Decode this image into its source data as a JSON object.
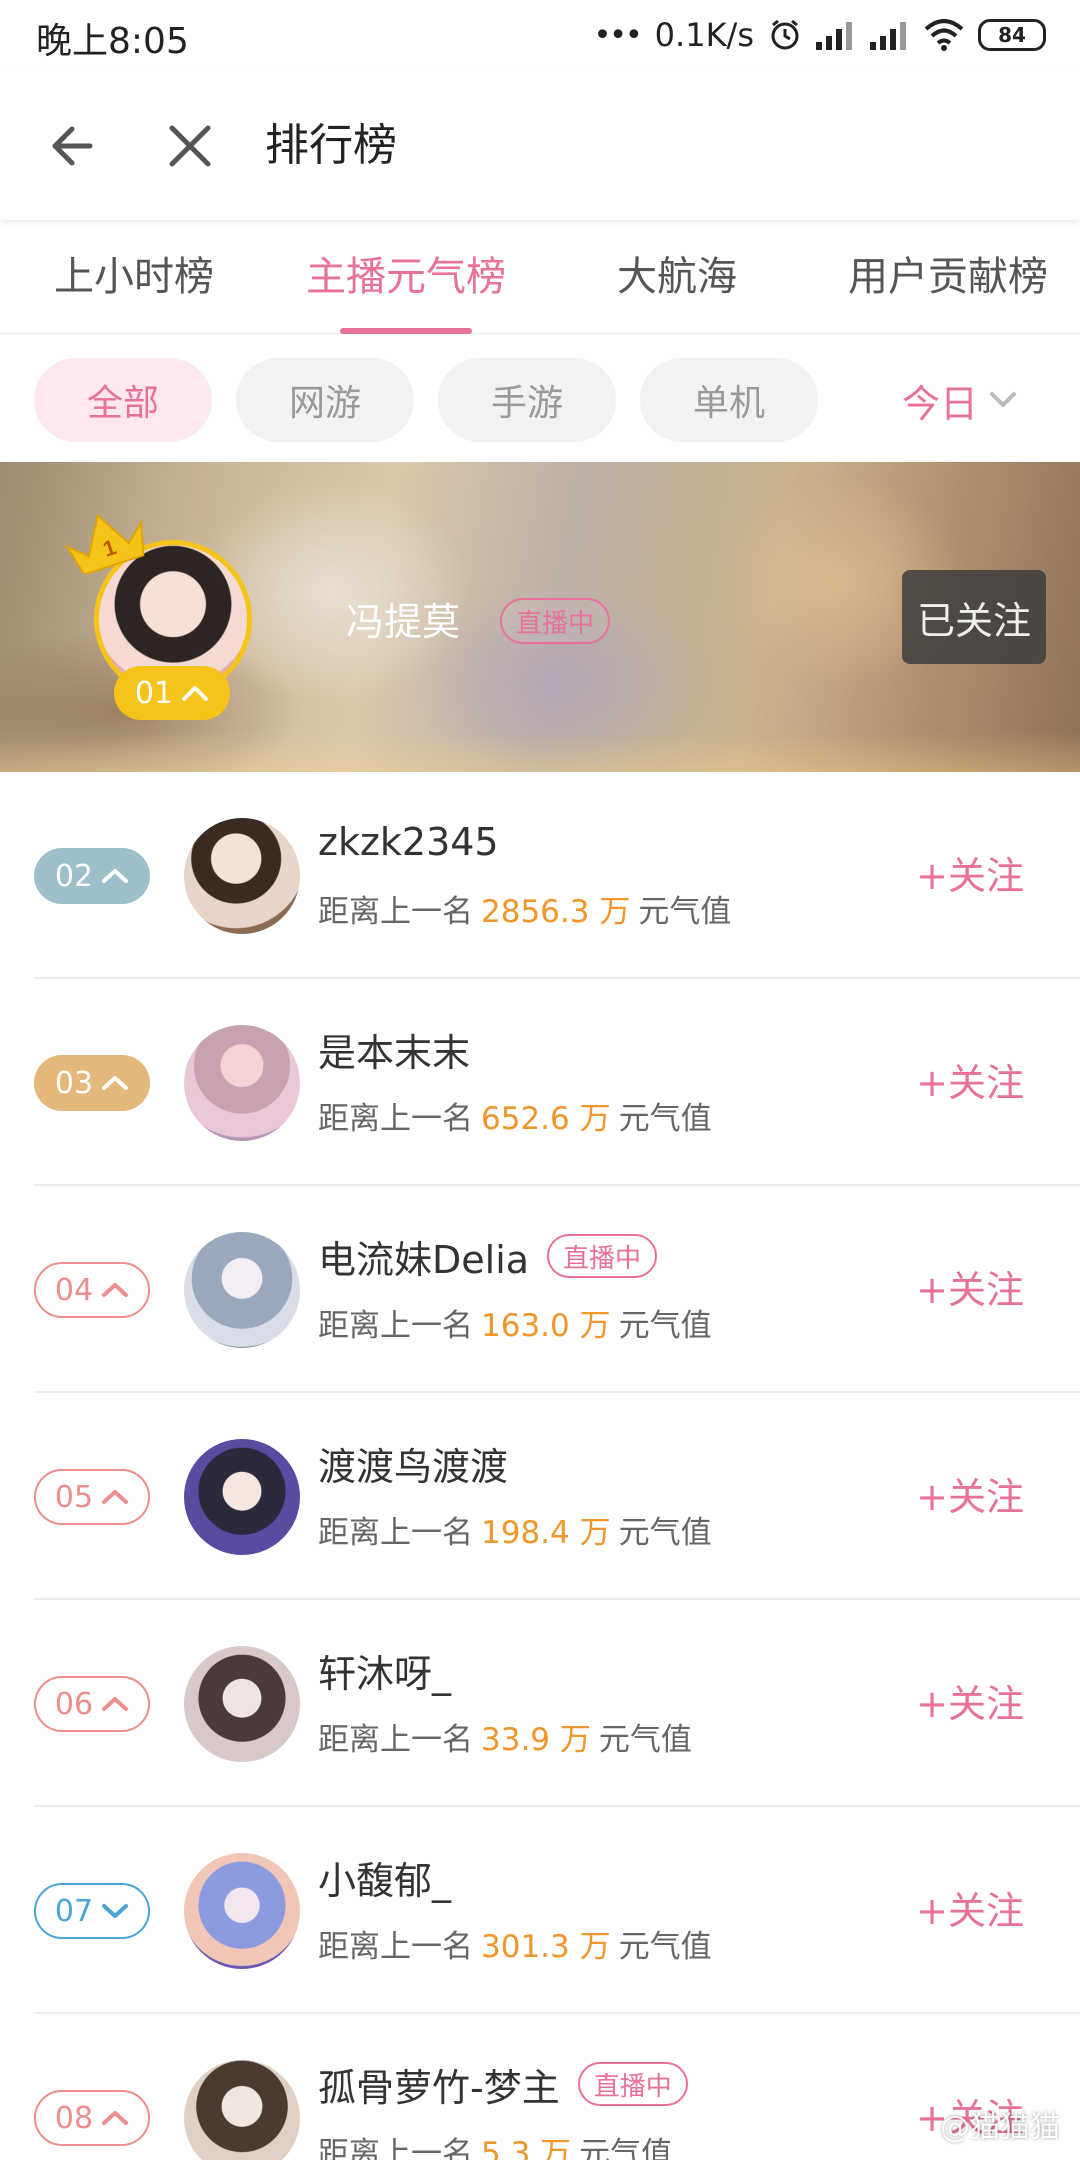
{
  "status_bar": {
    "time": "晚上8:05",
    "network_speed": "0.1K/s",
    "battery": "84"
  },
  "header": {
    "title": "排行榜"
  },
  "tabs": [
    {
      "label": "上小时榜",
      "active": false
    },
    {
      "label": "主播元气榜",
      "active": true
    },
    {
      "label": "大航海",
      "active": false
    },
    {
      "label": "用户贡献榜",
      "active": false
    }
  ],
  "filters": {
    "chips": [
      {
        "label": "全部",
        "active": true
      },
      {
        "label": "网游",
        "active": false
      },
      {
        "label": "手游",
        "active": false
      },
      {
        "label": "单机",
        "active": false
      }
    ],
    "date_range": "今日"
  },
  "top_ranked": {
    "rank": "01",
    "crown_number": "1",
    "trend": "up",
    "name": "冯提莫",
    "live_label": "直播中",
    "follow_label": "已关注"
  },
  "list": {
    "gap_prefix": "距离上一名",
    "gap_unit": "万",
    "gap_suffix": "元气值",
    "follow_label": "+关注",
    "live_label": "直播中",
    "rows": [
      {
        "rank": "02",
        "trend": "up",
        "name": "zkzk2345",
        "gap": "2856.3",
        "live": false,
        "rank_color": "#9cbfca",
        "rank_style": "filled"
      },
      {
        "rank": "03",
        "trend": "up",
        "name": "是本末末",
        "gap": "652.6",
        "live": false,
        "rank_color": "#e3b87a",
        "rank_style": "filled"
      },
      {
        "rank": "04",
        "trend": "up",
        "name": "电流妹Delia",
        "gap": "163.0",
        "live": true,
        "rank_color": "#ee8d8d",
        "rank_style": "outline"
      },
      {
        "rank": "05",
        "trend": "up",
        "name": "渡渡鸟渡渡",
        "gap": "198.4",
        "live": false,
        "rank_color": "#ee8d8d",
        "rank_style": "outline"
      },
      {
        "rank": "06",
        "trend": "up",
        "name": "轩沐呀_",
        "gap": "33.9",
        "live": false,
        "rank_color": "#ee8d8d",
        "rank_style": "outline"
      },
      {
        "rank": "07",
        "trend": "down",
        "name": "小馥郁_",
        "gap": "301.3",
        "live": false,
        "rank_color": "#4aa4d8",
        "rank_style": "outline"
      },
      {
        "rank": "08",
        "trend": "up",
        "name": "孤骨萝竹-梦主",
        "gap": "5.3",
        "live": true,
        "rank_color": "#ee8d8d",
        "rank_style": "outline"
      }
    ]
  },
  "watermark": "@猫猫猫",
  "colors": {
    "accent": "#e8709a",
    "value": "#f0962b",
    "gold": "#f6c319"
  },
  "icons": [
    "back-arrow-icon",
    "close-icon",
    "chevron-down-icon",
    "chevron-up-icon",
    "crown-icon",
    "signal-icon",
    "wifi-icon",
    "alarm-icon",
    "battery-icon"
  ]
}
